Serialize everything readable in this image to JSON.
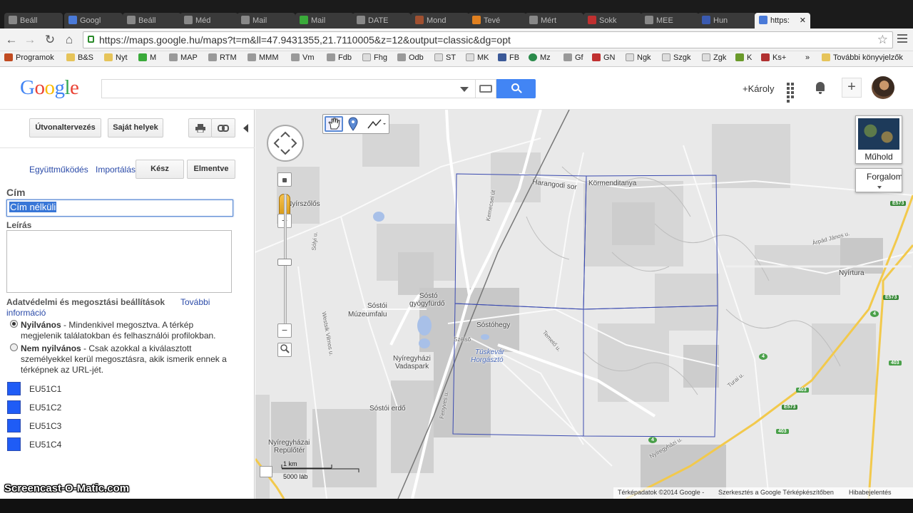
{
  "browser": {
    "tabs": [
      {
        "label": "Beáll"
      },
      {
        "label": "Googl"
      },
      {
        "label": "Beáll"
      },
      {
        "label": "Méd"
      },
      {
        "label": "Mail"
      },
      {
        "label": "Mail"
      },
      {
        "label": "DATE"
      },
      {
        "label": "Mond"
      },
      {
        "label": "Tevé"
      },
      {
        "label": "Mért"
      },
      {
        "label": "Sokk"
      },
      {
        "label": "MEE"
      },
      {
        "label": "Hun"
      },
      {
        "label": "https:"
      }
    ],
    "url": "https://maps.google.hu/maps?t=m&ll=47.9431355,21.7110005&z=12&output=classic&dg=opt",
    "bookmarks": [
      "Programok",
      "B&S",
      "Nyt",
      "M",
      "MAP",
      "RTM",
      "MMM",
      "Vm",
      "Fdb",
      "Fhg",
      "Odb",
      "ST",
      "MK",
      "FB",
      "Mz",
      "Gf",
      "GN",
      "Ngk",
      "Szgk",
      "Zgk",
      "K",
      "Ks+",
      "»",
      "További könyvjelzők"
    ]
  },
  "header": {
    "logo": "Google",
    "search_value": "",
    "user_name": "+Károly",
    "share_label": "+"
  },
  "panel": {
    "directions_button": "Útvonaltervezés",
    "my_places_button": "Saját helyek",
    "collaborate_link": "Együttműködés",
    "import_link": "Importálás",
    "done_button": "Kész",
    "save_button": "Elmentve",
    "title_label": "Cím",
    "title_value": "Cím nélküli",
    "description_label": "Leírás",
    "description_value": "",
    "privacy_label": "Adatvédelmi és megosztási beállítások",
    "more_info_link_1": "További",
    "more_info_link_2": "információ",
    "public_title": "Nyilvános",
    "public_desc_1": " - Mindenkivel megosztva. A térkép",
    "public_desc_2": "megjelenik találatokban és felhasználói profilokban.",
    "unlisted_title": "Nem nyilvános",
    "unlisted_desc_1": " - Csak azokkal a kiválasztott",
    "unlisted_desc_2": "személyekkel kerül megosztásra, akik ismerik ennek a",
    "unlisted_desc_3": "térképnek az URL-jét.",
    "selected_privacy": "Nyilvános",
    "layers": [
      {
        "name": "EU51C1",
        "color": "#1f5cf6"
      },
      {
        "name": "EU51C2",
        "color": "#1f5cf6"
      },
      {
        "name": "EU51C3",
        "color": "#1f5cf6"
      },
      {
        "name": "EU51C4",
        "color": "#1f5cf6"
      }
    ]
  },
  "map": {
    "satellite_label": "Műhold",
    "traffic_label": "Forgalom",
    "scale_km": "1 km",
    "scale_ft": "5000 láb",
    "footer_data": "Térképadatok ©2014 Google -",
    "footer_edit": "Szerkesztés a Google Térképkészítőben",
    "footer_report": "Hibabejelentés",
    "labels": {
      "harangod": "Harangodi sor",
      "kormendi": "Körmenditanya",
      "nyirszolos": "Nyírszőlős",
      "sosto": "Sóstói",
      "muzeum": "Múzeumfalu",
      "sosto_gyogy": "Sóstó",
      "sosto_gyogy2": "gyógyfürdő",
      "sostohegy": "Sóstóhegy",
      "tuskevar": "Tüskevár",
      "horgaszto": "Horgásztó",
      "vadaspark_1": "Nyíregyházi",
      "vadaspark_2": "Vadaspark",
      "sostoi_erdo": "Sóstói erdő",
      "repuloter_1": "Nyíregyházai",
      "repuloter_2": "Repülőtér",
      "nyirtura": "Nyírtura",
      "arpad": "Árpád János u.",
      "nyiregyhazi_ut": "Nyíregyházi u.",
      "tura_u": "Turai u.",
      "kormendi_u": "Körmendi",
      "fenyves": "Fenyves u.",
      "sokszi": "Sólyi u.",
      "west": "Westsik Vilmos u.",
      "kemecsei": "Kemecsei út",
      "tegla": "Temető u.",
      "szelo": "Szélső"
    },
    "shields": [
      "E573",
      "E573",
      "E573",
      "4",
      "4",
      "4",
      "403",
      "403",
      "403"
    ]
  },
  "watermark": "Screencast-O-Matic.com"
}
